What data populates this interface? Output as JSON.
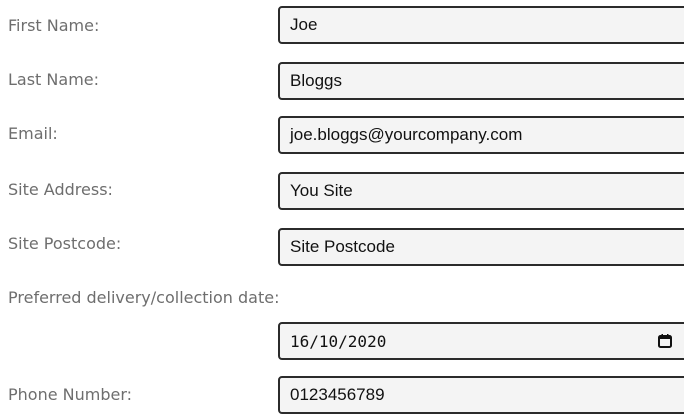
{
  "form": {
    "first_name": {
      "label": "First Name:",
      "value": "Joe"
    },
    "last_name": {
      "label": "Last Name:",
      "value": "Bloggs"
    },
    "email": {
      "label": "Email:",
      "value": "joe.bloggs@yourcompany.com"
    },
    "site_address": {
      "label": "Site Address:",
      "value": "You Site"
    },
    "site_postcode": {
      "label": "Site Postcode:",
      "value": "Site Postcode"
    },
    "delivery_date": {
      "label": "Preferred delivery/collection date:",
      "value": "16/10/2020",
      "icon": "calendar-icon"
    },
    "phone": {
      "label": "Phone Number:",
      "value": "0123456789"
    }
  }
}
